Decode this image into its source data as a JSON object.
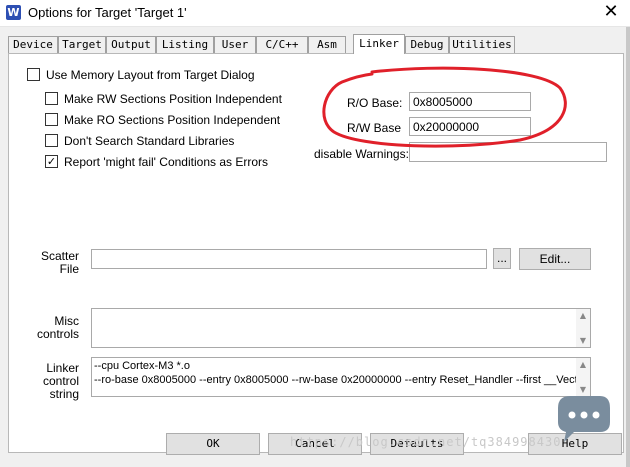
{
  "window": {
    "title": "Options for Target 'Target 1'",
    "icon": "uvision-app-icon",
    "close_glyph": "✕"
  },
  "tabs": [
    {
      "label": "Device",
      "active": false
    },
    {
      "label": "Target",
      "active": false
    },
    {
      "label": "Output",
      "active": false
    },
    {
      "label": "Listing",
      "active": false
    },
    {
      "label": "User",
      "active": false
    },
    {
      "label": "C/C++",
      "active": false
    },
    {
      "label": "Asm",
      "active": false
    },
    {
      "label": "Linker",
      "active": true
    },
    {
      "label": "Debug",
      "active": false
    },
    {
      "label": "Utilities",
      "active": false
    }
  ],
  "linker": {
    "use_memory_layout": {
      "label": "Use Memory Layout from Target Dialog",
      "checked": false
    },
    "make_rw_independent": {
      "label": "Make RW Sections Position Independent",
      "checked": false
    },
    "make_ro_independent": {
      "label": "Make RO Sections Position Independent",
      "checked": false
    },
    "dont_search_std_libs": {
      "label": "Don't Search Standard Libraries",
      "checked": false
    },
    "report_might_fail": {
      "label": "Report 'might fail' Conditions as Errors",
      "checked": true
    },
    "ro_base": {
      "label": "R/O Base:",
      "value": "0x8005000"
    },
    "rw_base": {
      "label": "R/W Base",
      "value": "0x20000000"
    },
    "disable_warnings": {
      "label": "disable Warnings:",
      "value": ""
    },
    "scatter_file": {
      "label_line1": "Scatter",
      "label_line2": "File",
      "value": "",
      "browse_label": "...",
      "edit_label": "Edit..."
    },
    "misc_controls": {
      "label_line1": "Misc",
      "label_line2": "controls",
      "value": ""
    },
    "linker_control_string": {
      "label_line1": "Linker",
      "label_line2": "control",
      "label_line3": "string",
      "line1": "--cpu Cortex-M3 *.o",
      "line2": "--ro-base 0x8005000 --entry 0x8005000 --rw-base 0x20000000 --entry Reset_Handler --first __Vectors -"
    }
  },
  "buttons": {
    "ok": "OK",
    "cancel": "Cancel",
    "defaults": "Defaults",
    "help": "Help"
  },
  "overlay": {
    "watermark": "https://blog.csdn.net/tq384998430",
    "annotation_color": "#e0202a",
    "badge_color": "#7a8d9e"
  }
}
